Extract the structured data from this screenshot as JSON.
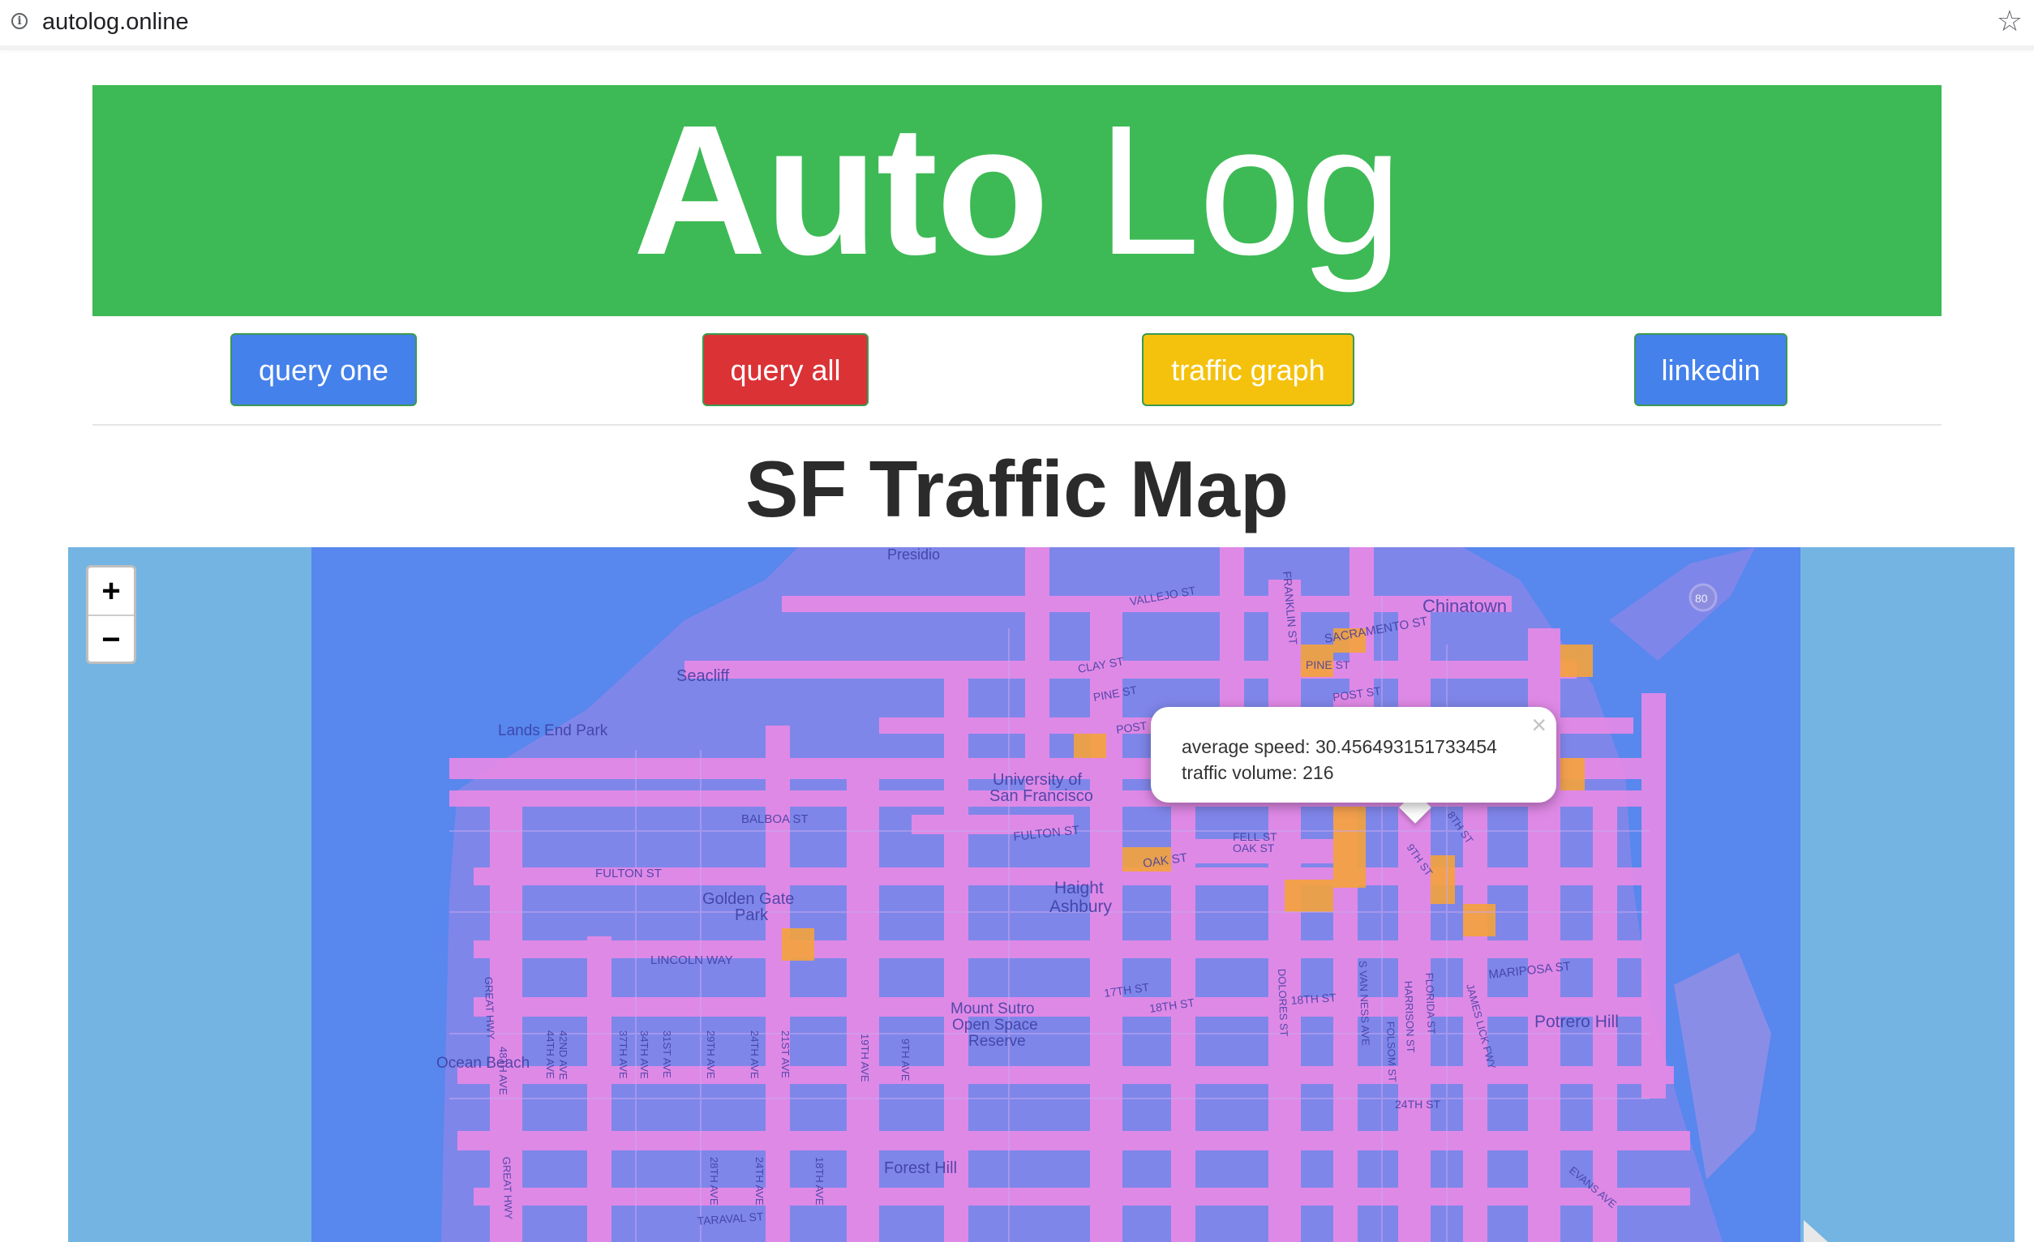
{
  "browser": {
    "url": "autolog.online",
    "info_icon": "info-icon",
    "bookmark_icon": "star-icon"
  },
  "header": {
    "brand_bold": "Auto",
    "brand_light": "Log",
    "brand_color": "#3dba55"
  },
  "nav": {
    "query_one": "query one",
    "query_all": "query all",
    "traffic_graph": "traffic graph",
    "linkedin": "linkedin",
    "colors": {
      "blue": "#4481eb",
      "red": "#db3236",
      "yellow": "#f4c20d"
    }
  },
  "page": {
    "title": "SF Traffic Map"
  },
  "map": {
    "zoom_in": "+",
    "zoom_out": "−",
    "popup": {
      "close": "×",
      "speed_label": "average speed: 30.456493151733454",
      "volume_label": "traffic volume: 216"
    },
    "labels": {
      "presidio": "Presidio",
      "vallejo": "VALLEJO ST",
      "chinatown": "Chinatown",
      "sacramento": "SACRAMENTO ST",
      "pine": "PINE ST",
      "post": "POST ST",
      "clay": "CLAY ST",
      "pine2": "PINE ST",
      "post2": "POST",
      "franklin": "FRANKLIN ST",
      "seacliff": "Seacliff",
      "lands_end": "Lands End Park",
      "usf": "University of",
      "usf2": "San Francisco",
      "balboa": "BALBOA ST",
      "fulton": "FULTON ST",
      "fulton2": "FULTON ST",
      "oak": "OAK ST",
      "fell": "FELL ST",
      "oak2": "OAK ST",
      "ninth": "9TH ST",
      "eighth": "8TH ST",
      "haight": "Haight",
      "ashbury": "Ashbury",
      "golden_gate": "Golden Gate",
      "park": "Park",
      "lincoln": "LINCOLN WAY",
      "great_hwy": "GREAT HWY",
      "great_hwy2": "GREAT HWY",
      "ocean_beach": "Ocean Beach",
      "mount_sutro": "Mount Sutro",
      "open_space": "Open Space",
      "reserve": "Reserve",
      "seventeenth": "17TH ST",
      "eighteenth": "18TH ST",
      "eighteenth2": "18TH ST",
      "dolores": "DOLORES ST",
      "van_ness": "S VAN NESS AVE",
      "harrison": "HARRISON ST",
      "folsom": "FOLSOM ST",
      "florida": "FLORIDA ST",
      "james_lick": "JAMES LICK FWY",
      "mariposa": "MARIPOSA ST",
      "potrero": "Potrero Hill",
      "twentyfourth": "24TH ST",
      "forest_hill": "Forest Hill",
      "taraval": "TARAVAL ST",
      "evans": "EVANS AVE",
      "highway": "80",
      "ave48": "48TH AVE",
      "ave42": "42ND AVE",
      "ave44": "44TH AVE",
      "ave37": "37TH AVE",
      "ave34": "34TH AVE",
      "ave31": "31ST AVE",
      "ave29": "29TH AVE",
      "ave24": "24TH AVE",
      "ave21": "21ST AVE",
      "ave9": "9TH AVE",
      "ave19": "19TH AVE",
      "ave18": "18TH AVE",
      "sunset_ave28": "28TH AVE",
      "sunset_ave24": "24TH AVE"
    }
  }
}
